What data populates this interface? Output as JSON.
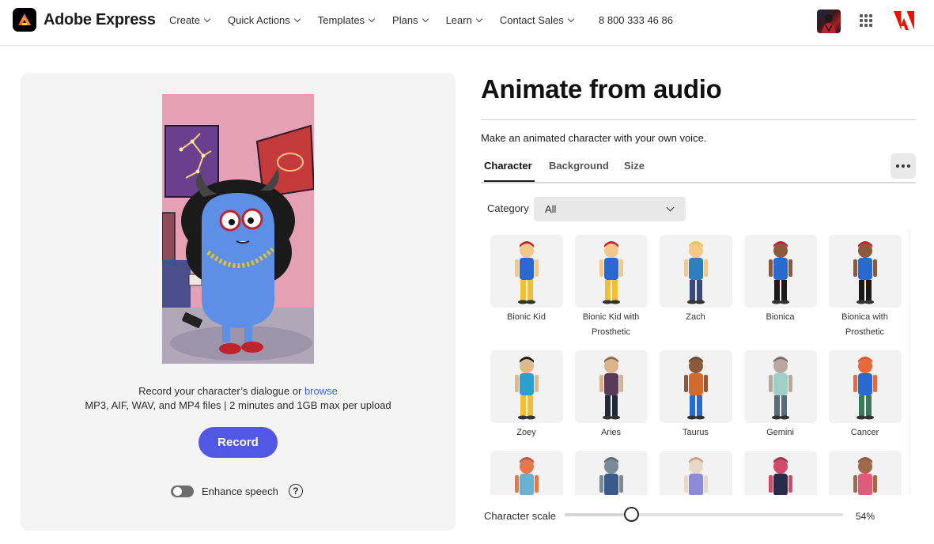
{
  "header": {
    "brand_name": "Adobe Express",
    "nav": [
      {
        "label": "Create"
      },
      {
        "label": "Quick Actions"
      },
      {
        "label": "Templates"
      },
      {
        "label": "Plans"
      },
      {
        "label": "Learn"
      },
      {
        "label": "Contact Sales"
      }
    ],
    "phone": "8 800 333 46 86",
    "icons": [
      "adobe-express-logo-icon",
      "user-avatar",
      "apps-grid-icon",
      "adobe-logo-icon"
    ]
  },
  "left": {
    "record_prompt": "Record your character’s dialogue or",
    "browse_link": "browse",
    "file_info": "MP3, AIF, WAV, and MP4 files | 2 minutes and 1GB max per upload",
    "record_button": "Record",
    "enhance_label": "Enhance speech",
    "enhance_on": false,
    "help_glyph": "?"
  },
  "right": {
    "title": "Animate from audio",
    "subtitle": "Make an animated character with your own voice.",
    "tabs": [
      {
        "label": "Character",
        "active": true
      },
      {
        "label": "Background",
        "active": false
      },
      {
        "label": "Size",
        "active": false
      }
    ],
    "category_label": "Category",
    "category_value": "All",
    "characters": [
      {
        "name": "Bionic Kid"
      },
      {
        "name": "Bionic Kid with Prosthetic"
      },
      {
        "name": "Zach"
      },
      {
        "name": "Bionica"
      },
      {
        "name": "Bionica with Prosthetic"
      },
      {
        "name": "Zoey"
      },
      {
        "name": "Aries"
      },
      {
        "name": "Taurus"
      },
      {
        "name": "Gemini"
      },
      {
        "name": "Cancer"
      },
      {
        "name": ""
      },
      {
        "name": ""
      },
      {
        "name": ""
      },
      {
        "name": ""
      },
      {
        "name": ""
      }
    ],
    "scale_label": "Character scale",
    "scale_value": "54%",
    "scale_fraction": 0.24
  },
  "colors": {
    "accent": "#5258e4",
    "link": "#3b63e0",
    "adobe_red": "#eb1000"
  }
}
